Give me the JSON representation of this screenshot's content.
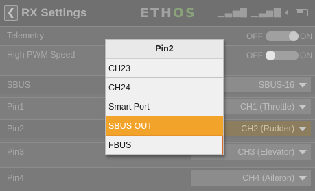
{
  "header": {
    "title": "RX Settings",
    "brand_part1": "ETH",
    "brand_part2": "OS",
    "signal_icons": "Al..ll"
  },
  "rows": {
    "telemetry": {
      "label": "Telemetry",
      "off": "OFF",
      "on": "ON",
      "state": "on"
    },
    "high_pwm": {
      "label": "High PWM Speed",
      "off": "OFF",
      "on": "ON",
      "state": "off"
    },
    "sbus": {
      "label": "SBUS",
      "value": "SBUS-16"
    },
    "pin1": {
      "label": "Pin1",
      "value": "CH1 (Throttle)"
    },
    "pin2": {
      "label": "Pin2",
      "value": "CH2 (Rudder)"
    },
    "pin3": {
      "label": "Pin3",
      "value": "CH3 (Elevator)"
    },
    "pin4": {
      "label": "Pin4",
      "value": "CH4 (Aileron)"
    }
  },
  "popup": {
    "title": "Pin2",
    "items": [
      "CH23",
      "CH24",
      "Smart Port",
      "SBUS OUT",
      "FBUS"
    ],
    "selected": "SBUS OUT"
  },
  "colors": {
    "accent": "#f2a42a",
    "background": "#7e7e7e"
  },
  "icons": {
    "back": "chevron-left-icon",
    "caret": "caret-down-icon",
    "battery": "battery-icon"
  }
}
